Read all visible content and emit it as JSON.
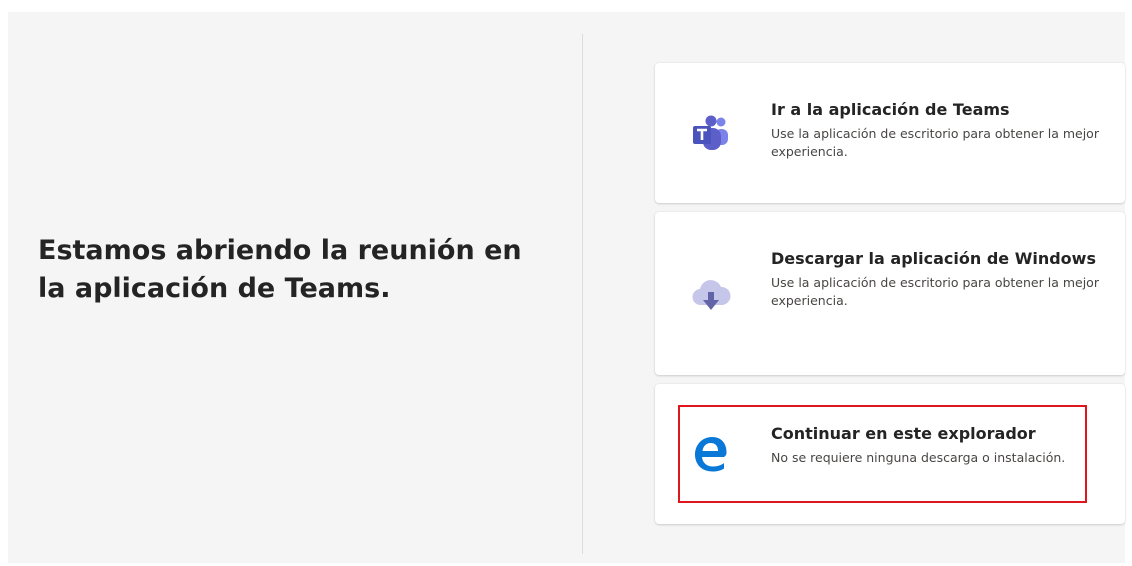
{
  "left": {
    "headline": "Estamos abriendo la reunión en la aplicación de Teams."
  },
  "options": [
    {
      "title": "Ir a la aplicación de Teams",
      "description": "Use la aplicación de escritorio para obtener la mejor experiencia.",
      "icon": "teams-icon"
    },
    {
      "title": "Descargar la aplicación de Windows",
      "description": "Use la aplicación de escritorio para obtener la mejor experiencia.",
      "icon": "cloud-download-icon"
    },
    {
      "title": "Continuar en este explorador",
      "description": "No se requiere ninguna descarga o instalación.",
      "icon": "edge-browser-icon",
      "highlight_color": "#e0161d"
    }
  ],
  "colors": {
    "background": "#f5f5f5",
    "card": "#ffffff",
    "teams_purple": "#5b5fc7",
    "cloud_lavender": "#c5c6ea",
    "edge_blue": "#0a78d7"
  }
}
